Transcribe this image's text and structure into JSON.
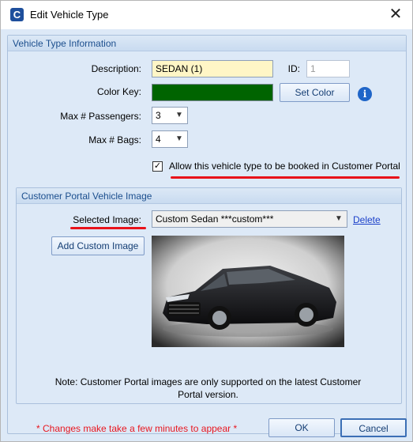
{
  "window": {
    "title": "Edit Vehicle Type",
    "app_icon_letter": "C"
  },
  "vehicle_info": {
    "group_title": "Vehicle Type Information",
    "description_label": "Description:",
    "description_value": "SEDAN (1)",
    "id_label": "ID:",
    "id_value": "1",
    "color_key_label": "Color Key:",
    "color_key_value": "#006400",
    "set_color_label": "Set Color",
    "max_passengers_label": "Max # Passengers:",
    "max_passengers_value": "3",
    "max_bags_label": "Max # Bags:",
    "max_bags_value": "4",
    "allow_portal_label": "Allow this vehicle type to be booked in Customer Portal",
    "allow_portal_checked": true
  },
  "portal_image": {
    "group_title": "Customer Portal Vehicle Image",
    "selected_image_label": "Selected Image:",
    "selected_image_value": "Custom Sedan   ***custom***",
    "delete_label": "Delete",
    "add_custom_label": "Add Custom Image",
    "note": "Note: Customer Portal images are only supported on the latest Customer Portal version."
  },
  "footer": {
    "warning": "* Changes make take a few minutes to appear *",
    "ok_label": "OK",
    "cancel_label": "Cancel"
  },
  "colors": {
    "highlight_red": "#e8121a",
    "accent_blue": "#1c4f8e"
  },
  "icons": [
    "app-logo-icon",
    "close-icon",
    "info-icon",
    "checkmark-icon",
    "chevron-down-icon"
  ]
}
